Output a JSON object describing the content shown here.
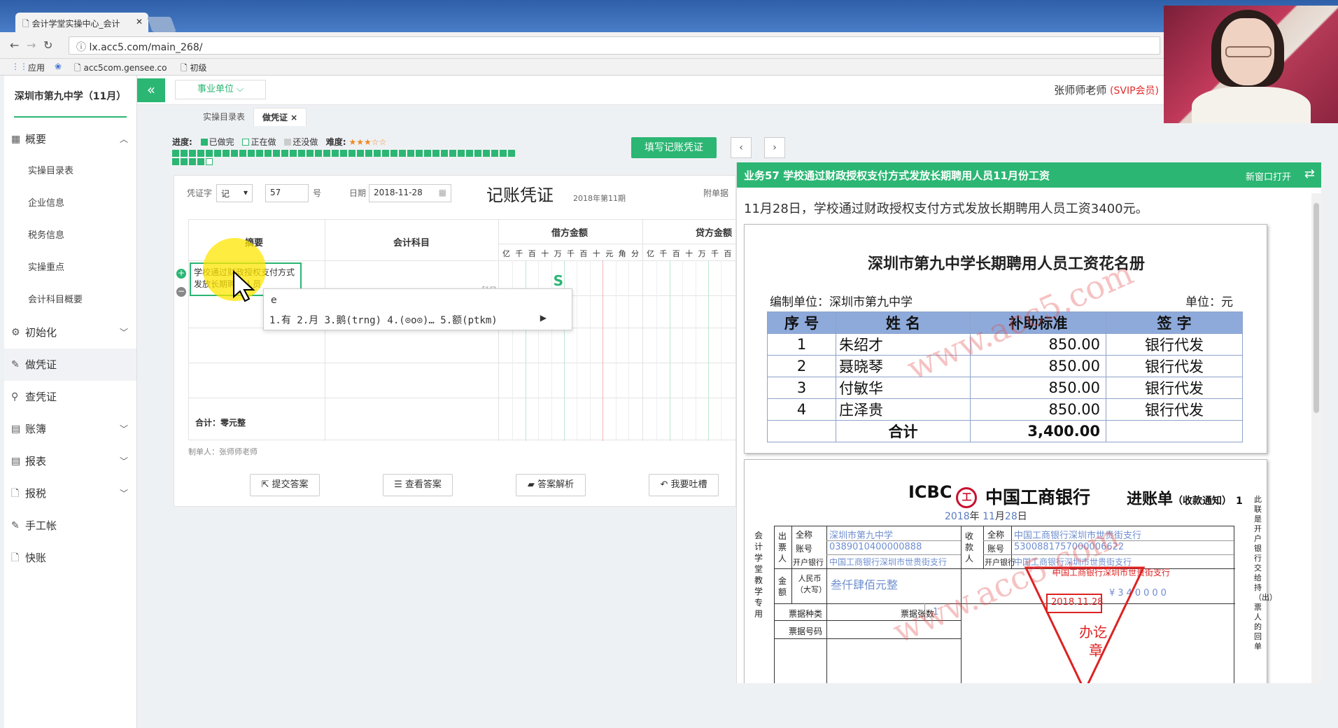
{
  "browser": {
    "tab_title": "会计学堂实操中心_会计",
    "url": "lx.acc5.com/main_268/",
    "bookmarks": [
      "应用",
      "acc5com.gensee.co",
      "初级"
    ]
  },
  "sidebar": {
    "school": "深圳市第九中学（11月）",
    "overview": "概要",
    "overview_items": [
      "实操目录表",
      "企业信息",
      "税务信息",
      "实操重点",
      "会计科目概要"
    ],
    "init": "初始化",
    "make_voucher": "做凭证",
    "check_voucher": "查凭证",
    "ledger": "账簿",
    "report": "报表",
    "tax": "报税",
    "manual": "手工帐",
    "quick": "快账"
  },
  "topbar": {
    "collapse": "«",
    "unit": "事业单位 ⌵",
    "teacher": "张师师老师",
    "vip": "(SVIP会员)"
  },
  "pagetabs": [
    "实操目录表",
    "做凭证 ×"
  ],
  "progress": {
    "label": "进度:",
    "done": "已做完",
    "doing": "正在做",
    "todo": "还没做",
    "difficulty": "难度:",
    "stars": "★★★☆☆"
  },
  "fill_button": "填写记账凭证",
  "nav": {
    "prev": "‹",
    "next": "›"
  },
  "voucher": {
    "word_label": "凭证字",
    "word": "记",
    "number": "57",
    "hao": "号",
    "date_label": "日期",
    "date": "2018-11-28",
    "title": "记账凭证",
    "period": "2018年第11期",
    "attach_label": "附单据",
    "h_summary": "摘要",
    "h_subject": "会计科目",
    "h_debit": "借方金额",
    "h_credit": "贷方金额",
    "digits": [
      "亿",
      "千",
      "百",
      "十",
      "万",
      "千",
      "百",
      "十",
      "元",
      "角",
      "分"
    ],
    "summary_text": "学校通过财政授权支付方式发放长期聘用人员",
    "subject_hint": "科目",
    "total": "合计：零元整",
    "maker": "制单人：张师师老师"
  },
  "ime": {
    "input": "e",
    "candidates": "1.有  2.月  3.鹅(trng)  4.(⊙o⊙)…  5.额(ptkm)"
  },
  "actions": [
    "提交答案",
    "查看答案",
    "答案解析",
    "我要吐槽"
  ],
  "panel": {
    "title": "业务57 学校通过财政授权支付方式发放长期聘用人员11月份工资",
    "new_window": "新窗口打开",
    "swap": "⇄",
    "desc": "11月28日，学校通过财政授权支付方式发放长期聘用人员工资3400元。"
  },
  "payroll": {
    "title": "深圳市第九中学长期聘用人员工资花名册",
    "org_label": "编制单位：深圳市第九中学",
    "unit_label": "单位：元",
    "headers": [
      "序  号",
      "姓  名",
      "补助标准",
      "签  字"
    ],
    "rows": [
      [
        "1",
        "朱绍才",
        "850.00",
        "银行代发"
      ],
      [
        "2",
        "聂晓琴",
        "850.00",
        "银行代发"
      ],
      [
        "3",
        "付敏华",
        "850.00",
        "银行代发"
      ],
      [
        "4",
        "庄泽贵",
        "850.00",
        "银行代发"
      ]
    ],
    "total_label": "合计",
    "total": "3,400.00"
  },
  "bank_slip": {
    "icbc": "ICBC",
    "logo": "工",
    "bank": "中国工商银行",
    "title": "进账单",
    "subtitle": "（收款通知）",
    "no": "1",
    "date_y": "2018",
    "date_m": "11",
    "date_d": "28",
    "y": "年",
    "m": "月",
    "d": "日",
    "payer_side": "出票人",
    "payee_side": "收款人",
    "full_name": "全称",
    "account": "账号",
    "bank_label": "开户银行",
    "payer_name": "深圳市第九中学",
    "payer_account": "0389010400000888",
    "payer_bank": "中国工商银行深圳市世贵街支行",
    "payee_name": "中国工商银行深圳市世贵街支行",
    "payee_account": "5300881757000006622",
    "payee_bank": "中国工商银行深圳市世贵街支行",
    "amount_side": "金额",
    "rmb": "人民币（大写）",
    "amount_words": "叁仟肆佰元整",
    "amount_digits": "¥340000",
    "bill_type": "票据种类",
    "bill_count": "票据张数",
    "bill_count_val": "1",
    "bill_no": "票据号码",
    "left_vertical": "会计学堂教学专用",
    "right_vertical": "此联是开户银行交给持（出）票人的回单",
    "stamp_date": "2018.11.28",
    "stamp_text1": "办讫",
    "stamp_text2": "章",
    "stamp_bank": "中国工商银行深圳市世贵街支行"
  },
  "watermark": "www.acc5.com"
}
